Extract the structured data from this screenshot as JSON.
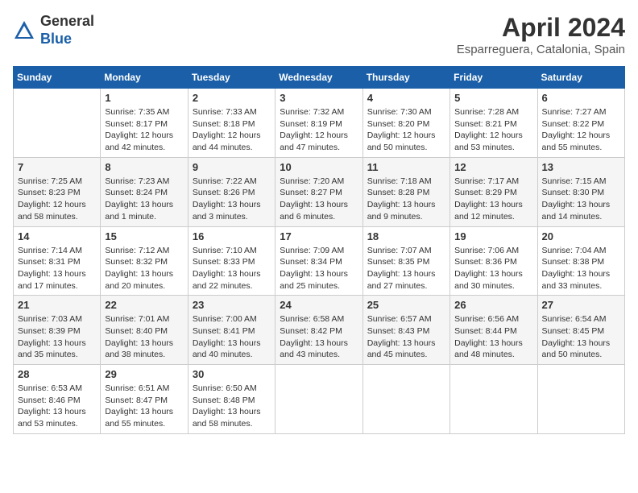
{
  "header": {
    "logo_general": "General",
    "logo_blue": "Blue",
    "title": "April 2024",
    "subtitle": "Esparreguera, Catalonia, Spain"
  },
  "columns": [
    "Sunday",
    "Monday",
    "Tuesday",
    "Wednesday",
    "Thursday",
    "Friday",
    "Saturday"
  ],
  "weeks": [
    [
      {
        "day": "",
        "info": ""
      },
      {
        "day": "1",
        "info": "Sunrise: 7:35 AM\nSunset: 8:17 PM\nDaylight: 12 hours\nand 42 minutes."
      },
      {
        "day": "2",
        "info": "Sunrise: 7:33 AM\nSunset: 8:18 PM\nDaylight: 12 hours\nand 44 minutes."
      },
      {
        "day": "3",
        "info": "Sunrise: 7:32 AM\nSunset: 8:19 PM\nDaylight: 12 hours\nand 47 minutes."
      },
      {
        "day": "4",
        "info": "Sunrise: 7:30 AM\nSunset: 8:20 PM\nDaylight: 12 hours\nand 50 minutes."
      },
      {
        "day": "5",
        "info": "Sunrise: 7:28 AM\nSunset: 8:21 PM\nDaylight: 12 hours\nand 53 minutes."
      },
      {
        "day": "6",
        "info": "Sunrise: 7:27 AM\nSunset: 8:22 PM\nDaylight: 12 hours\nand 55 minutes."
      }
    ],
    [
      {
        "day": "7",
        "info": "Sunrise: 7:25 AM\nSunset: 8:23 PM\nDaylight: 12 hours\nand 58 minutes."
      },
      {
        "day": "8",
        "info": "Sunrise: 7:23 AM\nSunset: 8:24 PM\nDaylight: 13 hours\nand 1 minute."
      },
      {
        "day": "9",
        "info": "Sunrise: 7:22 AM\nSunset: 8:26 PM\nDaylight: 13 hours\nand 3 minutes."
      },
      {
        "day": "10",
        "info": "Sunrise: 7:20 AM\nSunset: 8:27 PM\nDaylight: 13 hours\nand 6 minutes."
      },
      {
        "day": "11",
        "info": "Sunrise: 7:18 AM\nSunset: 8:28 PM\nDaylight: 13 hours\nand 9 minutes."
      },
      {
        "day": "12",
        "info": "Sunrise: 7:17 AM\nSunset: 8:29 PM\nDaylight: 13 hours\nand 12 minutes."
      },
      {
        "day": "13",
        "info": "Sunrise: 7:15 AM\nSunset: 8:30 PM\nDaylight: 13 hours\nand 14 minutes."
      }
    ],
    [
      {
        "day": "14",
        "info": "Sunrise: 7:14 AM\nSunset: 8:31 PM\nDaylight: 13 hours\nand 17 minutes."
      },
      {
        "day": "15",
        "info": "Sunrise: 7:12 AM\nSunset: 8:32 PM\nDaylight: 13 hours\nand 20 minutes."
      },
      {
        "day": "16",
        "info": "Sunrise: 7:10 AM\nSunset: 8:33 PM\nDaylight: 13 hours\nand 22 minutes."
      },
      {
        "day": "17",
        "info": "Sunrise: 7:09 AM\nSunset: 8:34 PM\nDaylight: 13 hours\nand 25 minutes."
      },
      {
        "day": "18",
        "info": "Sunrise: 7:07 AM\nSunset: 8:35 PM\nDaylight: 13 hours\nand 27 minutes."
      },
      {
        "day": "19",
        "info": "Sunrise: 7:06 AM\nSunset: 8:36 PM\nDaylight: 13 hours\nand 30 minutes."
      },
      {
        "day": "20",
        "info": "Sunrise: 7:04 AM\nSunset: 8:38 PM\nDaylight: 13 hours\nand 33 minutes."
      }
    ],
    [
      {
        "day": "21",
        "info": "Sunrise: 7:03 AM\nSunset: 8:39 PM\nDaylight: 13 hours\nand 35 minutes."
      },
      {
        "day": "22",
        "info": "Sunrise: 7:01 AM\nSunset: 8:40 PM\nDaylight: 13 hours\nand 38 minutes."
      },
      {
        "day": "23",
        "info": "Sunrise: 7:00 AM\nSunset: 8:41 PM\nDaylight: 13 hours\nand 40 minutes."
      },
      {
        "day": "24",
        "info": "Sunrise: 6:58 AM\nSunset: 8:42 PM\nDaylight: 13 hours\nand 43 minutes."
      },
      {
        "day": "25",
        "info": "Sunrise: 6:57 AM\nSunset: 8:43 PM\nDaylight: 13 hours\nand 45 minutes."
      },
      {
        "day": "26",
        "info": "Sunrise: 6:56 AM\nSunset: 8:44 PM\nDaylight: 13 hours\nand 48 minutes."
      },
      {
        "day": "27",
        "info": "Sunrise: 6:54 AM\nSunset: 8:45 PM\nDaylight: 13 hours\nand 50 minutes."
      }
    ],
    [
      {
        "day": "28",
        "info": "Sunrise: 6:53 AM\nSunset: 8:46 PM\nDaylight: 13 hours\nand 53 minutes."
      },
      {
        "day": "29",
        "info": "Sunrise: 6:51 AM\nSunset: 8:47 PM\nDaylight: 13 hours\nand 55 minutes."
      },
      {
        "day": "30",
        "info": "Sunrise: 6:50 AM\nSunset: 8:48 PM\nDaylight: 13 hours\nand 58 minutes."
      },
      {
        "day": "",
        "info": ""
      },
      {
        "day": "",
        "info": ""
      },
      {
        "day": "",
        "info": ""
      },
      {
        "day": "",
        "info": ""
      }
    ]
  ]
}
